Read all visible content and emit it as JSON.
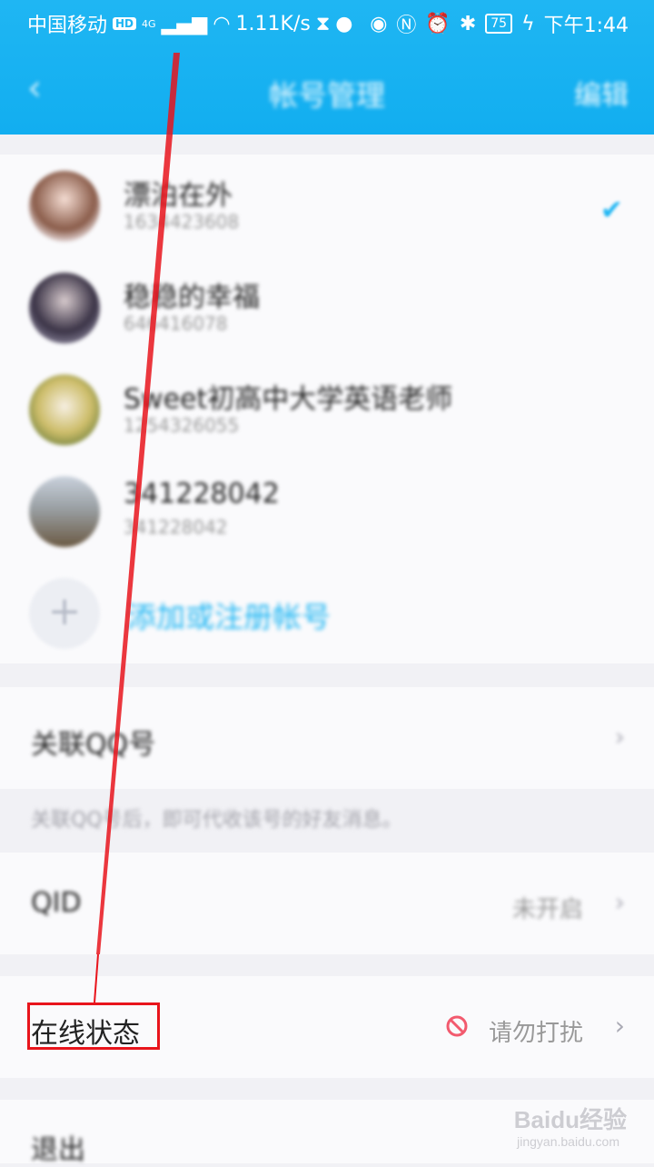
{
  "status_bar": {
    "carrier": "中国移动",
    "hd": "HD",
    "network": "4G",
    "speed": "1.11K/s",
    "battery": "75",
    "time": "下午1:44"
  },
  "nav": {
    "back_icon": "chevron-left-icon",
    "title": "帐号管理",
    "edit_label": "编辑"
  },
  "accounts": [
    {
      "name": "漂泊在外",
      "id": "1634423608",
      "selected": true
    },
    {
      "name": "稳稳的幸福",
      "id": "646416078",
      "selected": false
    },
    {
      "name": "Sweet初高中大学英语老师",
      "id": "1254326055",
      "selected": false
    },
    {
      "name": "341228042",
      "id": "341228042",
      "selected": false
    }
  ],
  "add_account_label": "添加或注册帐号",
  "link_qq": {
    "label": "关联QQ号",
    "hint": "关联QQ号后，即可代收该号的好友消息。"
  },
  "qid": {
    "label": "QID",
    "value": "未开启"
  },
  "online_status": {
    "label": "在线状态",
    "value": "请勿打扰",
    "icon": "do-not-disturb-icon"
  },
  "logout": {
    "label": "退出"
  },
  "watermark": {
    "brand": "Baidu经验",
    "url": "jingyan.baidu.com"
  },
  "colors": {
    "header": "#1fb6f3",
    "accent": "#1fb6f3",
    "annotation": "#e8141c"
  }
}
